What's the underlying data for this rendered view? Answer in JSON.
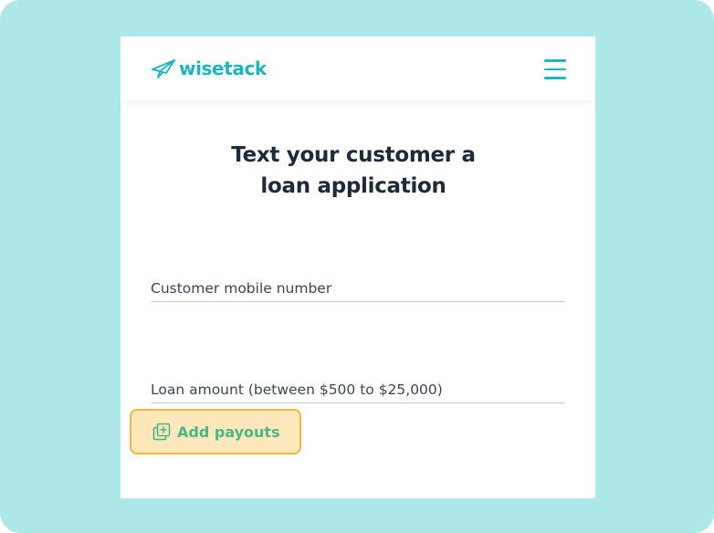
{
  "brand": {
    "name": "wisetack",
    "logo_icon": "paper-plane-bird-icon",
    "color": "#1db5c0"
  },
  "header": {
    "menu_icon": "hamburger-menu-icon"
  },
  "form": {
    "title_line1": "Text your customer a",
    "title_line2": "loan application",
    "phone_placeholder": "Customer mobile number",
    "phone_value": "",
    "amount_placeholder": "Loan amount (between $500 to $25,000)",
    "amount_value": ""
  },
  "payouts": {
    "label": "Add payouts",
    "icon": "add-copy-icon",
    "label_color": "#48b985",
    "highlight_border": "#f4b63c",
    "highlight_fill": "#fde7bb"
  },
  "colors": {
    "background": "#ade8e8",
    "title": "#1d2a3a",
    "accent": "#1db5c0"
  }
}
